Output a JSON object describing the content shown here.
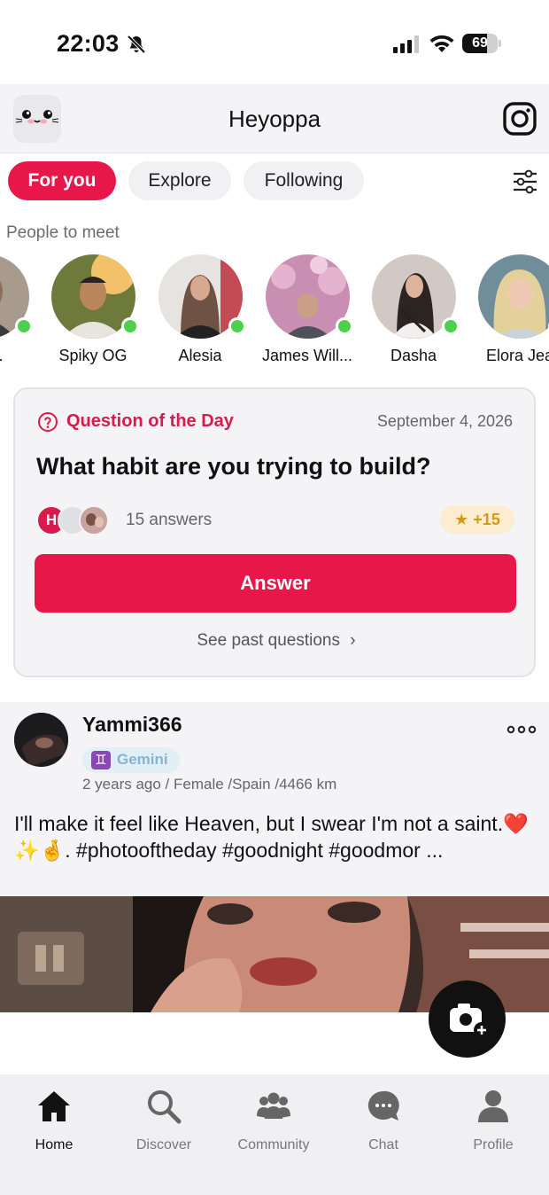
{
  "status_bar": {
    "time": "22:03",
    "battery_level": "69",
    "battery_fraction": 0.69,
    "icons": [
      "bell-off-icon",
      "cellular-signal-icon",
      "wifi-icon",
      "battery-icon"
    ]
  },
  "header": {
    "title": "Heyoppa",
    "logo_icon": "cat-face-logo",
    "right_icon": "instagram-icon"
  },
  "tabs": [
    {
      "label": "For you",
      "active": true
    },
    {
      "label": "Explore",
      "active": false
    },
    {
      "label": "Following",
      "active": false
    }
  ],
  "people_to_meet": {
    "title": "People to meet",
    "people": [
      {
        "name": "Xa...",
        "online": true,
        "color": "#8a6f5c"
      },
      {
        "name": "Spiky OG",
        "online": true,
        "color": "#b9903c"
      },
      {
        "name": "Alesia",
        "online": true,
        "color": "#6e5344"
      },
      {
        "name": "James Will...",
        "online": true,
        "color": "#c98fb3"
      },
      {
        "name": "Dasha",
        "online": true,
        "color": "#d2c9c4"
      },
      {
        "name": "Elora Jea",
        "online": true,
        "color": "#6f8e99"
      }
    ]
  },
  "question_of_the_day": {
    "label": "Question of the Day",
    "date": "September 4, 2026",
    "question": "What habit are you trying to build?",
    "answers": "15 answers",
    "answer_avatar_initial": "H",
    "points": "+15",
    "answer_button": "Answer",
    "see_past": "See past questions"
  },
  "post": {
    "username": "Yammi366",
    "zodiac": "Gemini",
    "zodiac_symbol": "♊",
    "meta": "2 years ago / Female /Spain /4466 km",
    "text": "I'll make it feel like Heaven, but I swear I'm not a saint.❤️✨🤞. #photooftheday #goodnight #goodmor ..."
  },
  "bottom_nav": [
    {
      "label": "Home",
      "icon": "home-icon",
      "active": true
    },
    {
      "label": "Discover",
      "icon": "search-icon",
      "active": false
    },
    {
      "label": "Community",
      "icon": "community-icon",
      "active": false
    },
    {
      "label": "Chat",
      "icon": "chat-icon",
      "active": false
    },
    {
      "label": "Profile",
      "icon": "profile-icon",
      "active": false
    }
  ],
  "colors": {
    "accent": "#e8174a",
    "online": "#4cd14c",
    "points": "#d49a17"
  }
}
